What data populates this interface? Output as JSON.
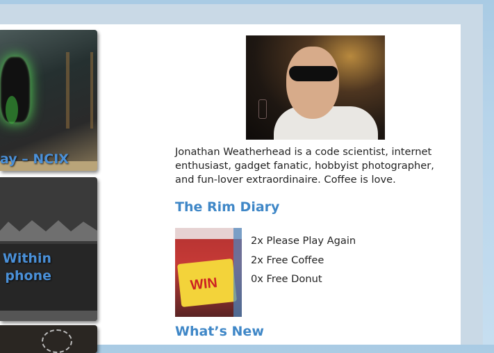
{
  "cards": [
    {
      "title": "ay – NCIX"
    },
    {
      "title_line1": "Within",
      "title_line2": "phone"
    },
    {
      "title": ""
    }
  ],
  "profile": {
    "bio": "Jonathan Weatherhead is a code scientist, internet enthusiast, gadget fanatic, hobbyist photographer, and fun-lover extraordinaire. Coffee is love."
  },
  "rim_diary": {
    "heading": "The Rim Diary",
    "cup_text": "WIN",
    "items": [
      "2x Please Play Again",
      "2x Free Coffee",
      "0x Free Donut"
    ]
  },
  "whats_new": {
    "heading": "What’s New"
  },
  "colors": {
    "accent": "#3f87c7",
    "background": "#b7d4ea",
    "panel": "#ffffff"
  }
}
